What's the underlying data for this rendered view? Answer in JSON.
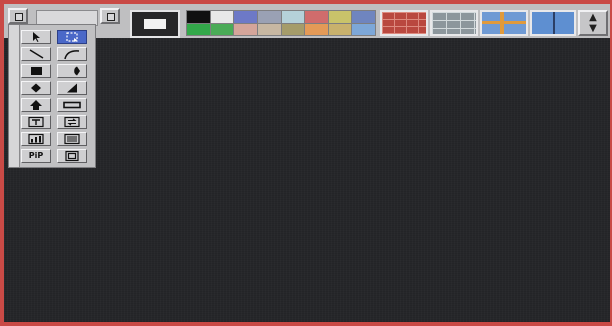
{
  "app": {
    "title": ""
  },
  "colors": {
    "frame": "#c94a46",
    "canvas": "#232427",
    "selected_tool": "#4a68c8",
    "current_foreground": "#262628",
    "current_swatch": "#f2f2f2"
  },
  "palette": {
    "swatches": [
      "#101010",
      "#e8e8e8",
      "#6d79c7",
      "#9aa1b4",
      "#b5d1d9",
      "#d06c6c",
      "#c9c36a",
      "#6f85bf",
      "#33a84a",
      "#4aab57",
      "#d4a59a",
      "#c7b7a2",
      "#a59c6a",
      "#e49a57",
      "#c8b16d",
      "#7da7d8"
    ]
  },
  "patterns": [
    {
      "name": "red-brick"
    },
    {
      "name": "gray-brick"
    },
    {
      "name": "window-cross"
    },
    {
      "name": "glass-panel"
    }
  ],
  "tools": [
    {
      "name": "select-arrow-tool",
      "icon": "arrow-cursor",
      "label": ""
    },
    {
      "name": "marquee-tool",
      "icon": "dashed-rectangle",
      "label": ""
    },
    {
      "name": "line-tool",
      "icon": "diagonal-line",
      "label": ""
    },
    {
      "name": "arc-tool",
      "icon": "curve",
      "label": ""
    },
    {
      "name": "box-tool",
      "icon": "filled-block",
      "label": ""
    },
    {
      "name": "wedge-tool",
      "icon": "half-disc",
      "label": ""
    },
    {
      "name": "diamond-tool",
      "icon": "diamond",
      "label": ""
    },
    {
      "name": "ramp-tool",
      "icon": "ramp",
      "label": ""
    },
    {
      "name": "arrow-up-tool",
      "icon": "up-arrow-shape",
      "label": ""
    },
    {
      "name": "bar-tool",
      "icon": "horizontal-bar",
      "label": ""
    },
    {
      "name": "text-frame-tool",
      "icon": "text-frame",
      "label": ""
    },
    {
      "name": "swap-tool",
      "icon": "swap-arrows",
      "label": ""
    },
    {
      "name": "chart-tool",
      "icon": "bar-chart",
      "label": ""
    },
    {
      "name": "list-tool",
      "icon": "list-lines",
      "label": ""
    },
    {
      "name": "pip-tool",
      "icon": "",
      "label": "PiP"
    },
    {
      "name": "frame-tool",
      "icon": "inset-frame",
      "label": ""
    }
  ],
  "scroll": {
    "up_glyph": "▲",
    "down_glyph": "▼"
  }
}
